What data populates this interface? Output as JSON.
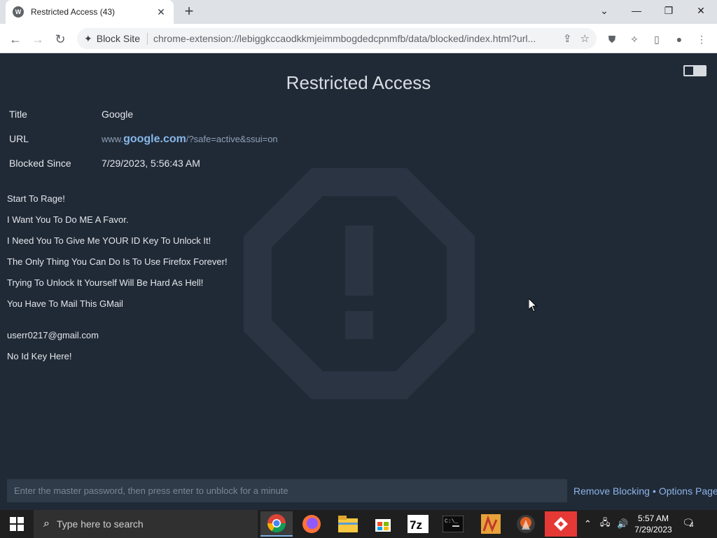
{
  "browser": {
    "tab_title": "Restricted Access (43)",
    "favicon_letter": "W",
    "site_chip": "Block Site",
    "url": "chrome-extension://lebiggkccaodkkmjeimmbogdedcpnmfb/data/blocked/index.html?url..."
  },
  "page": {
    "heading": "Restricted Access",
    "info": [
      {
        "label": "Title",
        "value": "Google"
      },
      {
        "label": "URL",
        "value_prefix": "www.",
        "value_host": "google.com",
        "value_suffix": "/?safe=active&ssui=on"
      },
      {
        "label": "Blocked Since",
        "value": "7/29/2023, 5:56:43 AM"
      }
    ],
    "messages": [
      "Start To Rage!",
      "I Want You To Do ME A Favor.",
      "I Need You To Give Me YOUR ID Key To Unlock It!",
      "The Only Thing You Can Do Is To Use Firefox Forever!",
      "Trying To Unlock It Yourself Will Be Hard As Hell!",
      "You Have To Mail This GMail"
    ],
    "email": "userr0217@gmail.com",
    "no_key": "No Id Key Here!",
    "password_placeholder": "Enter the master password, then press enter to unblock for a minute",
    "remove_blocking": "Remove Blocking",
    "separator": "•",
    "options_page": "Options Page"
  },
  "taskbar": {
    "search_placeholder": "Type here to search",
    "time": "5:57 AM",
    "date": "7/29/2023",
    "notifications": "4",
    "apps": [
      "chrome-icon",
      "firefox-icon",
      "file-explorer-icon",
      "store-icon",
      "7zip-icon",
      "terminal-icon",
      "app-icon",
      "app-icon",
      "app-icon"
    ]
  },
  "colors": {
    "page_bg": "#202a37",
    "accent_link": "#8db4e8"
  }
}
